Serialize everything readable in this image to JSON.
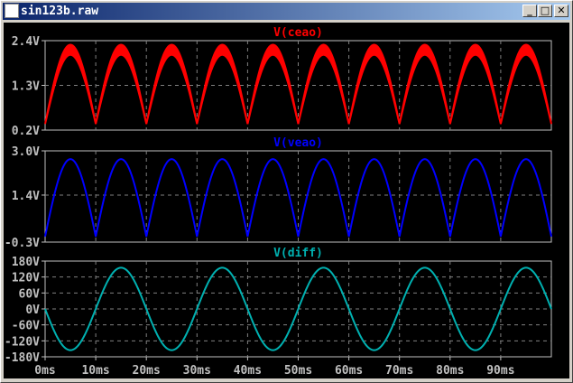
{
  "window": {
    "title": "sin123b.raw",
    "minimize": "_",
    "maximize": "□",
    "close": "✕"
  },
  "colors": {
    "ceao": "#ff0000",
    "veao": "#0000ff",
    "diff": "#00b0b0",
    "axis": "#c0c0c0",
    "grid": "#808080"
  },
  "chart_data": [
    {
      "type": "line",
      "title": "V(ceao)",
      "ylim": [
        0.2,
        2.4
      ],
      "yticks": [
        "2.4V",
        "1.3V",
        "0.2V"
      ],
      "ytick_values": [
        2.4,
        1.3,
        0.2
      ],
      "xlim": [
        0,
        100
      ],
      "series": [
        {
          "name": "V(ceao)",
          "formula": "full-wave rectified 50Hz band",
          "min": 0.35,
          "peak_upper": 2.3,
          "peak_lower": 2.05
        }
      ]
    },
    {
      "type": "line",
      "title": "V(veao)",
      "ylim": [
        -0.3,
        3.0
      ],
      "yticks": [
        "3.0V",
        "1.4V",
        "-0.3V"
      ],
      "ytick_values": [
        3.0,
        1.4,
        -0.3
      ],
      "xlim": [
        0,
        100
      ],
      "series": [
        {
          "name": "V(veao)",
          "min": -0.1,
          "peak": 2.7
        }
      ]
    },
    {
      "type": "line",
      "title": "V(diff)",
      "ylim": [
        -180,
        180
      ],
      "yticks": [
        "180V",
        "120V",
        "60V",
        "0V",
        "-60V",
        "-120V",
        "-180V"
      ],
      "ytick_values": [
        180,
        120,
        60,
        0,
        -60,
        -120,
        -180
      ],
      "xlim": [
        0,
        100
      ],
      "series": [
        {
          "name": "V(diff)",
          "amplitude": -155,
          "frequency_hz": 50
        }
      ]
    }
  ],
  "xaxis": {
    "ticks": [
      "0ms",
      "10ms",
      "20ms",
      "30ms",
      "40ms",
      "50ms",
      "60ms",
      "70ms",
      "80ms",
      "90ms"
    ],
    "values": [
      0,
      10,
      20,
      30,
      40,
      50,
      60,
      70,
      80,
      90
    ]
  }
}
